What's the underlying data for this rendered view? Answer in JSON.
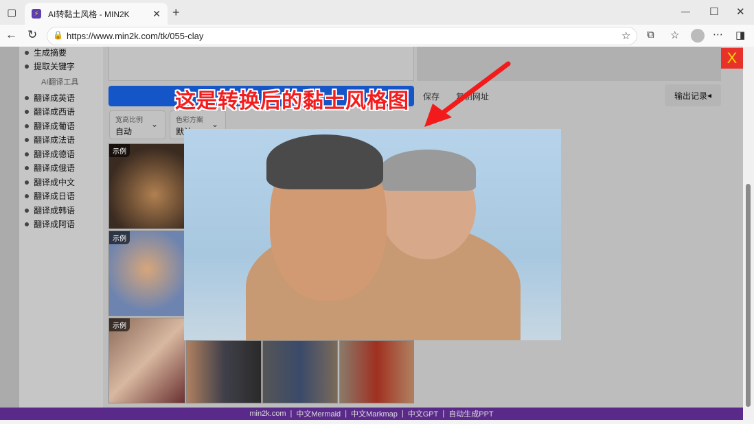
{
  "browser": {
    "tab_title": "AI转黏土风格 - MIN2K",
    "url": "https://www.min2k.com/tk/055-clay"
  },
  "sidebar": {
    "items_top": [
      "生成摘要",
      "提取关键字"
    ],
    "group": "AI翻译工具",
    "items": [
      "翻译成英语",
      "翻译成西语",
      "翻译成葡语",
      "翻译成法语",
      "翻译成德语",
      "翻译成俄语",
      "翻译成中文",
      "翻译成日语",
      "翻译成韩语",
      "翻译成阿语"
    ]
  },
  "toolbar": {
    "save": "保存",
    "copy_url": "复制网址",
    "history": "输出记录"
  },
  "selects": [
    {
      "label": "宽高比例",
      "value": "自动"
    },
    {
      "label": "色彩方案",
      "value": "默认"
    }
  ],
  "gallery": {
    "badge": "示例"
  },
  "annotation": "这是转换后的黏土风格图",
  "close": "X",
  "footer": {
    "links": [
      "min2k.com",
      "中文Mermaid",
      "中文Markmap",
      "中文GPT",
      "自动生成PPT"
    ],
    "sep": "|"
  },
  "colors": {
    "footer": "#5a2a8a",
    "generate_button": "#1455c8",
    "close": "#e8312a",
    "annotation": "#f41c1c"
  }
}
